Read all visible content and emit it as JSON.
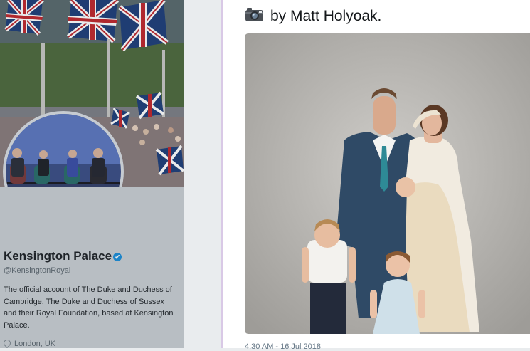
{
  "profile": {
    "name": "Kensington Palace",
    "verified_mark": "✔",
    "handle": "@KensingtonRoyal",
    "bio": "The official account of The Duke and Duchess of Cambridge, The Duke and Duchess of Sussex and their Royal Foundation, based at Kensington Palace.",
    "location": "London, UK",
    "location_icon": "location-pin-icon"
  },
  "tweet": {
    "icon": "camera-icon",
    "text": "by Matt Holyoak.",
    "timestamp": "4:30 AM - 16 Jul 2018"
  },
  "colors": {
    "verified": "#1b8ed8",
    "modal_border": "#d9c9e6",
    "text_primary": "#14171a",
    "text_secondary": "#657786"
  }
}
